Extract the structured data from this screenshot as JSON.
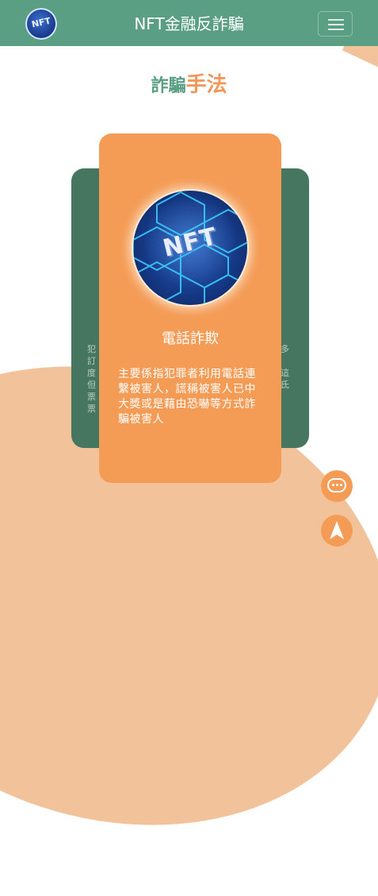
{
  "header": {
    "logo_text": "NFT",
    "title": "NFT金融反詐騙"
  },
  "section": {
    "title_part1": "詐騙",
    "title_part2": "手法"
  },
  "cards": {
    "left_partial_text": "犯\n訂\n度\n但\n票\n票",
    "right_partial_text": "多\n\n這\n氐",
    "active": {
      "image_text": "NFT",
      "title": "電話詐欺",
      "description": "主要係指犯罪者利用電話連繫被害人，謊稱被害人已中大獎或是藉由恐嚇等方式詐騙被害人"
    }
  },
  "icons": {
    "logo": "nft-coin-icon",
    "menu": "hamburger-menu-icon",
    "chat": "chat-bubble-icon",
    "top": "navigation-arrow-icon"
  },
  "colors": {
    "header": "#5a9e83",
    "accent": "#f49b55",
    "side_card": "#467560",
    "decoration": "#f2c39b"
  }
}
